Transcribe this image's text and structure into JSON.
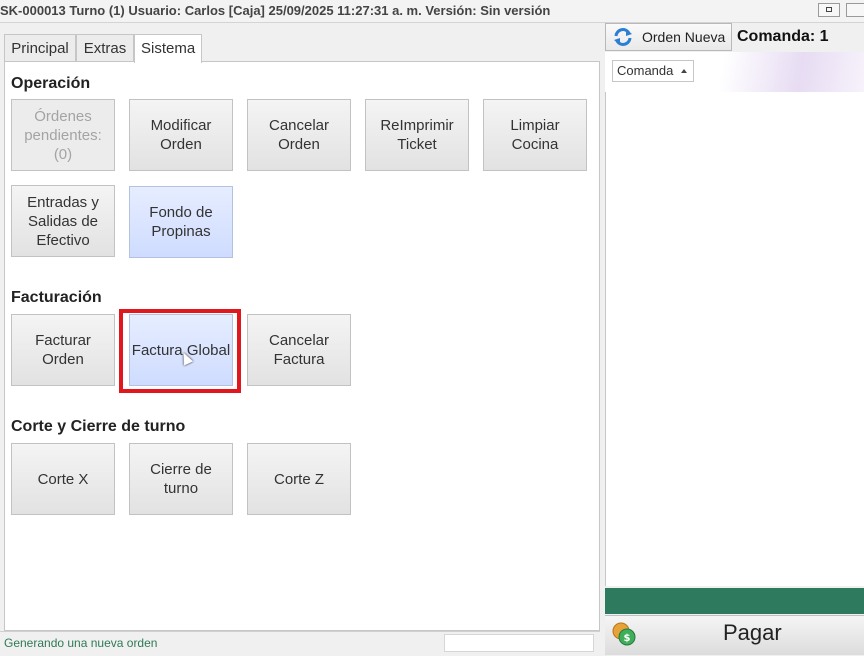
{
  "window": {
    "title": "SK-000013 Turno (1) Usuario: Carlos [Caja] 25/09/2025 11:27:31 a. m. Versión: Sin versión"
  },
  "tabs": [
    {
      "label": "Principal"
    },
    {
      "label": "Extras"
    },
    {
      "label": "Sistema"
    }
  ],
  "sections": {
    "operacion": {
      "title": "Operación",
      "buttons": [
        {
          "label": "Órdenes\npendientes:\n(0)"
        },
        {
          "label": "Modificar\nOrden"
        },
        {
          "label": "Cancelar\nOrden"
        },
        {
          "label": "ReImprimir\nTicket"
        },
        {
          "label": "Limpiar\nCocina"
        },
        {
          "label": "Entradas y\nSalidas de\nEfectivo"
        },
        {
          "label": "Fondo de\nPropinas"
        }
      ]
    },
    "facturacion": {
      "title": "Facturación",
      "buttons": [
        {
          "label": "Facturar\nOrden"
        },
        {
          "label": "Factura Global"
        },
        {
          "label": "Cancelar\nFactura"
        }
      ]
    },
    "corte": {
      "title": "Corte y Cierre de turno",
      "buttons": [
        {
          "label": "Corte X"
        },
        {
          "label": "Cierre de\nturno"
        },
        {
          "label": "Corte Z"
        }
      ]
    }
  },
  "right_panel": {
    "orden_nueva_label": "Orden Nueva",
    "comanda_label": "Comanda: 1",
    "column_header": "Comanda",
    "pagar_label": "Pagar"
  },
  "status": {
    "text": "Generando una nueva orden"
  },
  "colors": {
    "highlight": "#e0171d",
    "green_bar": "#2d7a5e",
    "status_text": "#2f7a55",
    "selected_button": "#cfdcff"
  },
  "icons": [
    "refresh-icon",
    "coin-icon",
    "sort-up-icon",
    "restore-icon",
    "mouse-cursor-icon"
  ]
}
